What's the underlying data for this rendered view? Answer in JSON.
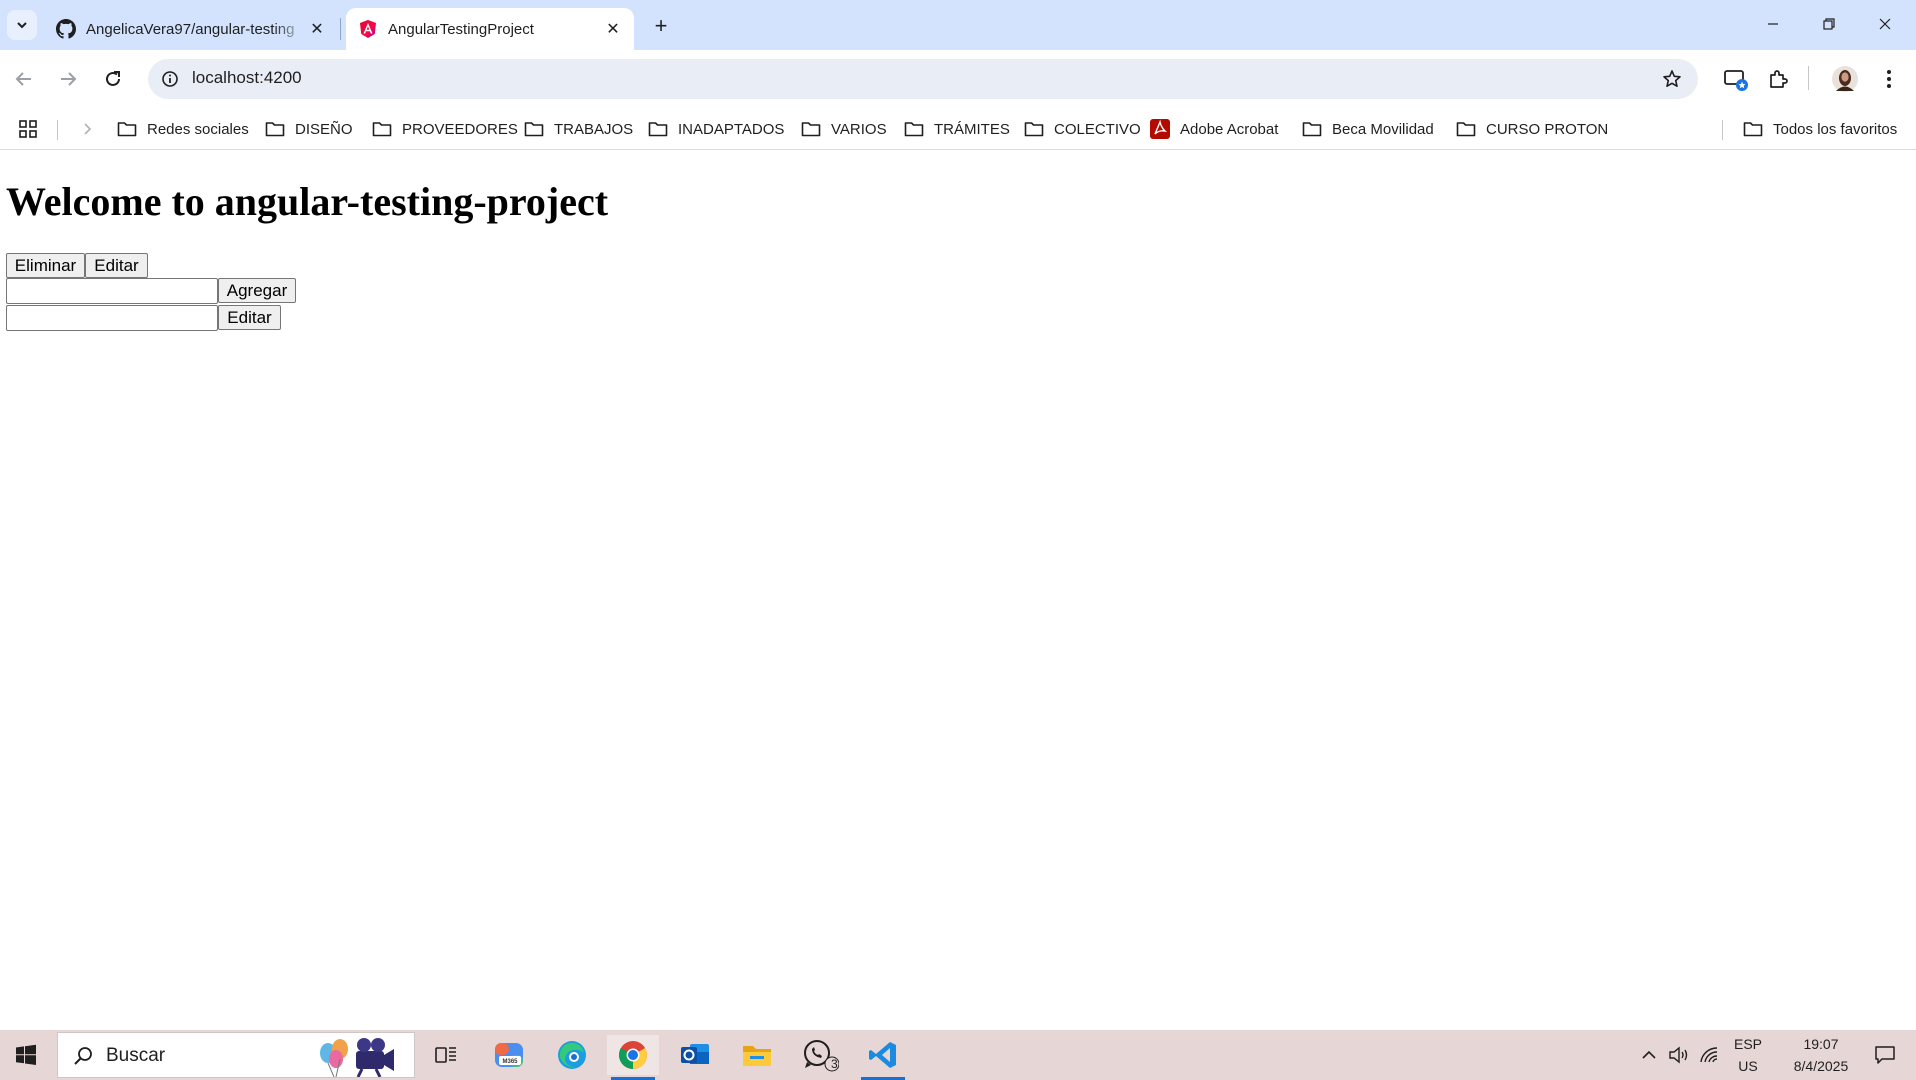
{
  "browser": {
    "tabs": [
      {
        "title": "AngelicaVera97/angular-testing",
        "icon": "github-icon",
        "active": false
      },
      {
        "title": "AngularTestingProject",
        "icon": "angular-icon",
        "active": true
      }
    ],
    "new_tab_label": "+",
    "address": "localhost:4200",
    "bookmarks": [
      {
        "label": "Redes sociales",
        "icon": "folder-icon"
      },
      {
        "label": "DISEÑO",
        "icon": "folder-icon"
      },
      {
        "label": "PROVEEDORES",
        "icon": "folder-icon"
      },
      {
        "label": "TRABAJOS",
        "icon": "folder-icon"
      },
      {
        "label": "INADAPTADOS",
        "icon": "folder-icon"
      },
      {
        "label": "VARIOS",
        "icon": "folder-icon"
      },
      {
        "label": "TRÁMITES",
        "icon": "folder-icon"
      },
      {
        "label": "COLECTIVO",
        "icon": "folder-icon"
      },
      {
        "label": "Adobe Acrobat",
        "icon": "acrobat-icon"
      },
      {
        "label": "Beca Movilidad",
        "icon": "folder-icon"
      },
      {
        "label": "CURSO PROTON",
        "icon": "folder-icon"
      }
    ],
    "all_bookmarks_label": "Todos los favoritos"
  },
  "page": {
    "heading": "Welcome to angular-testing-project",
    "buttons": {
      "delete": "Eliminar",
      "edit_top": "Editar",
      "add": "Agregar",
      "edit_bottom": "Editar"
    },
    "inputs": {
      "add_value": "",
      "edit_value": ""
    }
  },
  "taskbar": {
    "search_placeholder": "Buscar",
    "apps": [
      "start-icon",
      "task-view-icon",
      "m365-icon",
      "edge-icon",
      "chrome-icon",
      "outlook-icon",
      "file-explorer-icon",
      "whatsapp-icon",
      "vscode-icon"
    ],
    "whatsapp_badge": "3",
    "language": "ESP",
    "layout": "US",
    "time": "19:07",
    "date": "8/4/2025"
  },
  "colors": {
    "titlebar_bg": "#d3e3fd",
    "omnibox_bg": "#e9eef6",
    "taskbar_bg": "#e6d7d6",
    "accent": "#1a6fd1"
  }
}
